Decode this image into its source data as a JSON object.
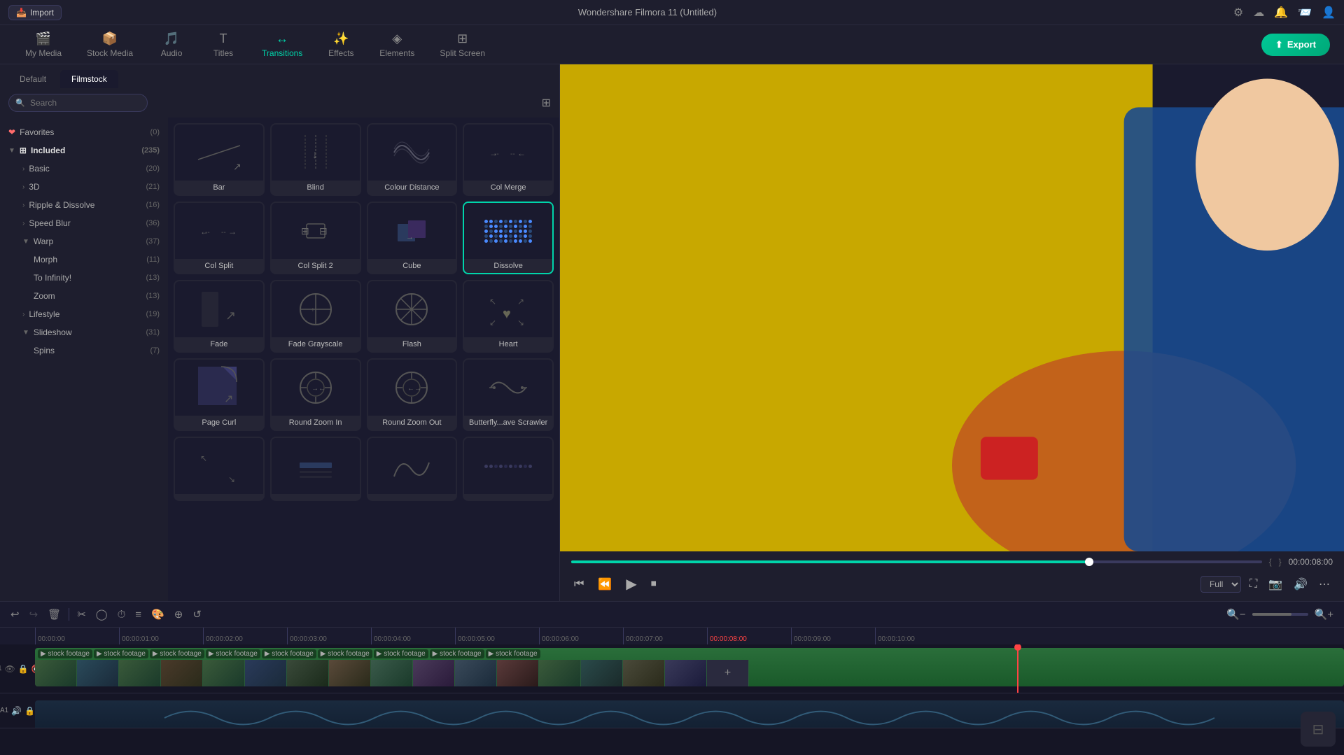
{
  "app": {
    "title": "Wondershare Filmora 11 (Untitled)",
    "import_label": "Import"
  },
  "nav": {
    "tabs": [
      {
        "id": "my-media",
        "label": "My Media",
        "icon": "🎬"
      },
      {
        "id": "stock-media",
        "label": "Stock Media",
        "icon": "📦"
      },
      {
        "id": "audio",
        "label": "Audio",
        "icon": "🎵"
      },
      {
        "id": "titles",
        "label": "Titles",
        "icon": "T"
      },
      {
        "id": "transitions",
        "label": "Transitions",
        "icon": "⟷",
        "active": true
      },
      {
        "id": "effects",
        "label": "Effects",
        "icon": "✨"
      },
      {
        "id": "elements",
        "label": "Elements",
        "icon": "◈"
      },
      {
        "id": "split-screen",
        "label": "Split Screen",
        "icon": "⊞"
      }
    ],
    "export_label": "Export"
  },
  "panel": {
    "tabs": [
      {
        "label": "Default",
        "active": false
      },
      {
        "label": "Filmstock",
        "active": true
      }
    ],
    "search_placeholder": "Search",
    "grid_icon": "⊞"
  },
  "sidebar": {
    "items": [
      {
        "id": "favorites",
        "label": "Favorites",
        "count": "(0)",
        "icon": "❤",
        "level": 0
      },
      {
        "id": "included",
        "label": "Included",
        "count": "(235)",
        "icon": "▼ ⊞",
        "level": 0,
        "expanded": true
      },
      {
        "id": "basic",
        "label": "Basic",
        "count": "(20)",
        "level": 1
      },
      {
        "id": "3d",
        "label": "3D",
        "count": "(21)",
        "level": 1
      },
      {
        "id": "ripple",
        "label": "Ripple & Dissolve",
        "count": "(16)",
        "level": 1
      },
      {
        "id": "speed-blur",
        "label": "Speed Blur",
        "count": "(36)",
        "level": 1
      },
      {
        "id": "warp",
        "label": "Warp",
        "count": "(37)",
        "level": 1,
        "expanded": true
      },
      {
        "id": "morph",
        "label": "Morph",
        "count": "(11)",
        "level": 2
      },
      {
        "id": "to-infinity",
        "label": "To Infinity!",
        "count": "(13)",
        "level": 2
      },
      {
        "id": "zoom",
        "label": "Zoom",
        "count": "(13)",
        "level": 2
      },
      {
        "id": "lifestyle",
        "label": "Lifestyle",
        "count": "(19)",
        "level": 1
      },
      {
        "id": "slideshow",
        "label": "Slideshow",
        "count": "(31)",
        "level": 1,
        "expanded": true
      },
      {
        "id": "spins",
        "label": "Spins",
        "count": "(7)",
        "level": 2
      }
    ]
  },
  "transitions": [
    {
      "id": "bar",
      "label": "Bar",
      "thumb": "bar"
    },
    {
      "id": "blind",
      "label": "Blind",
      "thumb": "blind"
    },
    {
      "id": "colour-distance",
      "label": "Colour Distance",
      "thumb": "colour-distance"
    },
    {
      "id": "col-merge",
      "label": "Col Merge",
      "thumb": "col-merge"
    },
    {
      "id": "col-split",
      "label": "Col Split",
      "thumb": "col-split"
    },
    {
      "id": "col-split-2",
      "label": "Col Split 2",
      "thumb": "col-split-2"
    },
    {
      "id": "cube",
      "label": "Cube",
      "thumb": "cube"
    },
    {
      "id": "dissolve",
      "label": "Dissolve",
      "thumb": "dissolve",
      "selected": true
    },
    {
      "id": "fade",
      "label": "Fade",
      "thumb": "fade"
    },
    {
      "id": "fade-grayscale",
      "label": "Fade Grayscale",
      "thumb": "fade-grayscale"
    },
    {
      "id": "flash",
      "label": "Flash",
      "thumb": "flash"
    },
    {
      "id": "heart",
      "label": "Heart",
      "thumb": "heart"
    },
    {
      "id": "page-curl",
      "label": "Page Curl",
      "thumb": "page-curl"
    },
    {
      "id": "round-zoom-in",
      "label": "Round Zoom In",
      "thumb": "round-zoom-in"
    },
    {
      "id": "round-zoom-out",
      "label": "Round Zoom Out",
      "thumb": "round-zoom-out"
    },
    {
      "id": "butterfly-scrawler",
      "label": "Butterfly...ave Scrawler",
      "thumb": "butterfly"
    }
  ],
  "player": {
    "time": "00:00:08:00",
    "quality": "Full",
    "progress": 75
  },
  "timeline": {
    "markers": [
      "00:00:00",
      "00:00:01:00",
      "00:00:02:00",
      "00:00:03:00",
      "00:00:04:00",
      "00:00:05:00",
      "00:00:06:00",
      "00:00:07:00",
      "00:00:08:00",
      "00:00:09:00",
      "00:00:10:00"
    ],
    "track1_label": "stock footage",
    "playhead_time": "00:00:08:00"
  }
}
